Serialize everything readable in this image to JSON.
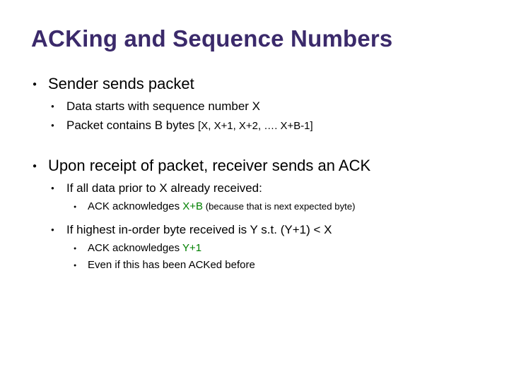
{
  "title": "ACKing and Sequence Numbers",
  "items": {
    "sender": {
      "heading": "Sender sends packet",
      "sub1": "Data starts with sequence number X",
      "sub2_a": "Packet contains B bytes ",
      "sub2_b": "[X, X+1, X+2, …. X+B-1]"
    },
    "receipt": {
      "heading": "Upon receipt of packet, receiver sends an ACK",
      "case1": {
        "text": " If all data prior to X already received:",
        "ack_a": "ACK acknowledges ",
        "ack_b": "X+B",
        "ack_c": " (because that is next expected byte)"
      },
      "case2": {
        "text": "If highest in-order byte received is Y s.t. (Y+1) < X",
        "ack_a": "ACK acknowledges ",
        "ack_b": "Y+1",
        "even": "Even if this has been ACKed before"
      }
    }
  }
}
